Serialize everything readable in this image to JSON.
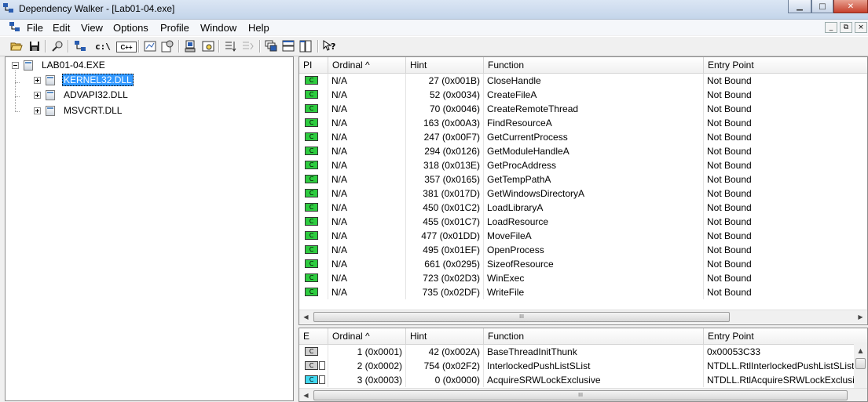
{
  "window": {
    "title": "Dependency Walker - [Lab01-04.exe]",
    "minimize_glyph": "▁",
    "maximize_glyph": "□",
    "close_glyph": "✕"
  },
  "menu": [
    "File",
    "Edit",
    "View",
    "Options",
    "Profile",
    "Window",
    "Help"
  ],
  "mdi_controls": [
    "_",
    "⧉",
    "×"
  ],
  "toolbar_icons": [
    "open-icon",
    "save-icon",
    "find-icon",
    "copy-icon",
    "full-paths-icon",
    "undecorate-cpp-icon",
    "auto-expand-icon",
    "properties-icon",
    "system-info-icon",
    "view-module-icon",
    "sort-icon",
    "configure-search-icon",
    "cascade-icon",
    "tile-horizontal-icon",
    "tile-vertical-icon",
    "help-icon"
  ],
  "toolbar_text": {
    "cpath": "c:\\",
    "cpp": "C++"
  },
  "tree": {
    "root": "LAB01-04.EXE",
    "children": [
      {
        "label": "KERNEL32.DLL",
        "selected": true
      },
      {
        "label": "ADVAPI32.DLL",
        "selected": false
      },
      {
        "label": "MSVCRT.DLL",
        "selected": false
      }
    ]
  },
  "imports": {
    "columns": [
      "PI",
      "Ordinal ^",
      "Hint",
      "Function",
      "Entry Point"
    ],
    "rows": [
      {
        "pi": "C",
        "ordinal": "N/A",
        "hint": "27 (0x001B)",
        "function": "CloseHandle",
        "entry": "Not Bound"
      },
      {
        "pi": "C",
        "ordinal": "N/A",
        "hint": "52 (0x0034)",
        "function": "CreateFileA",
        "entry": "Not Bound"
      },
      {
        "pi": "C",
        "ordinal": "N/A",
        "hint": "70 (0x0046)",
        "function": "CreateRemoteThread",
        "entry": "Not Bound"
      },
      {
        "pi": "C",
        "ordinal": "N/A",
        "hint": "163 (0x00A3)",
        "function": "FindResourceA",
        "entry": "Not Bound"
      },
      {
        "pi": "C",
        "ordinal": "N/A",
        "hint": "247 (0x00F7)",
        "function": "GetCurrentProcess",
        "entry": "Not Bound"
      },
      {
        "pi": "C",
        "ordinal": "N/A",
        "hint": "294 (0x0126)",
        "function": "GetModuleHandleA",
        "entry": "Not Bound"
      },
      {
        "pi": "C",
        "ordinal": "N/A",
        "hint": "318 (0x013E)",
        "function": "GetProcAddress",
        "entry": "Not Bound"
      },
      {
        "pi": "C",
        "ordinal": "N/A",
        "hint": "357 (0x0165)",
        "function": "GetTempPathA",
        "entry": "Not Bound"
      },
      {
        "pi": "C",
        "ordinal": "N/A",
        "hint": "381 (0x017D)",
        "function": "GetWindowsDirectoryA",
        "entry": "Not Bound"
      },
      {
        "pi": "C",
        "ordinal": "N/A",
        "hint": "450 (0x01C2)",
        "function": "LoadLibraryA",
        "entry": "Not Bound"
      },
      {
        "pi": "C",
        "ordinal": "N/A",
        "hint": "455 (0x01C7)",
        "function": "LoadResource",
        "entry": "Not Bound"
      },
      {
        "pi": "C",
        "ordinal": "N/A",
        "hint": "477 (0x01DD)",
        "function": "MoveFileA",
        "entry": "Not Bound"
      },
      {
        "pi": "C",
        "ordinal": "N/A",
        "hint": "495 (0x01EF)",
        "function": "OpenProcess",
        "entry": "Not Bound"
      },
      {
        "pi": "C",
        "ordinal": "N/A",
        "hint": "661 (0x0295)",
        "function": "SizeofResource",
        "entry": "Not Bound"
      },
      {
        "pi": "C",
        "ordinal": "N/A",
        "hint": "723 (0x02D3)",
        "function": "WinExec",
        "entry": "Not Bound"
      },
      {
        "pi": "C",
        "ordinal": "N/A",
        "hint": "735 (0x02DF)",
        "function": "WriteFile",
        "entry": "Not Bound"
      }
    ]
  },
  "exports": {
    "columns": [
      "E",
      "Ordinal ^",
      "Hint",
      "Function",
      "Entry Point"
    ],
    "rows": [
      {
        "e": "C",
        "forwarded": false,
        "ordinal": "1 (0x0001)",
        "hint": "42 (0x002A)",
        "function": "BaseThreadInitThunk",
        "entry": "0x00053C33"
      },
      {
        "e": "C",
        "forwarded": true,
        "ordinal": "2 (0x0002)",
        "hint": "754 (0x02F2)",
        "function": "InterlockedPushListSList",
        "entry": "NTDLL.RtlInterlockedPushListSList"
      },
      {
        "e": "C",
        "forwarded": true,
        "ordinal": "3 (0x0003)",
        "hint": "0 (0x0000)",
        "function": "AcquireSRWLockExclusive",
        "entry": "NTDLL.RtlAcquireSRWLockExclusive"
      }
    ]
  },
  "scrollbar": {
    "grip": "III",
    "left_arrow": "◀",
    "right_arrow": "▶",
    "up_arrow": "▲"
  },
  "colors": {
    "selection": "#3399ff",
    "import_icon": "#2ecc40",
    "export_forward_icon": "#40d8f0"
  }
}
